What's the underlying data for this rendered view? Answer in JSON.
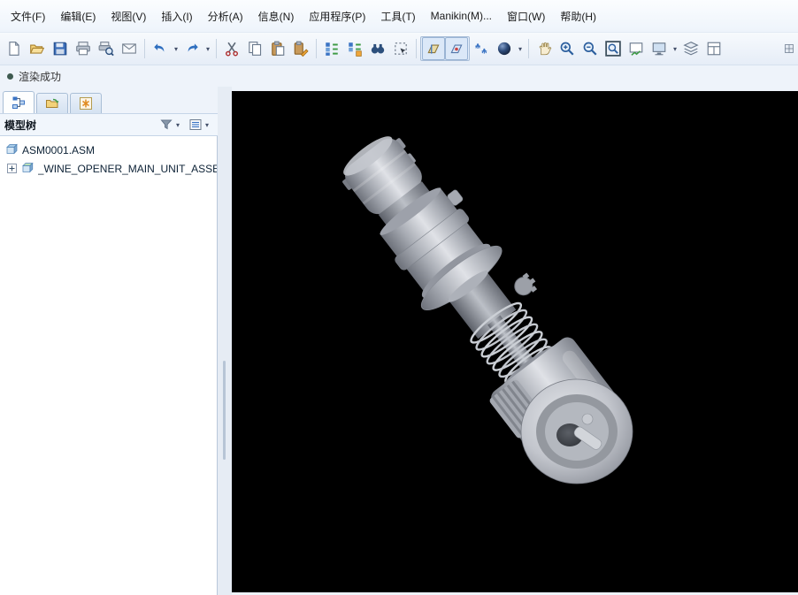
{
  "menubar": {
    "items": [
      {
        "label": "文件(F)"
      },
      {
        "label": "编辑(E)"
      },
      {
        "label": "视图(V)"
      },
      {
        "label": "插入(I)"
      },
      {
        "label": "分析(A)"
      },
      {
        "label": "信息(N)"
      },
      {
        "label": "应用程序(P)"
      },
      {
        "label": "工具(T)"
      },
      {
        "label": "Manikin(M)..."
      },
      {
        "label": "窗口(W)"
      },
      {
        "label": "帮助(H)"
      }
    ]
  },
  "toolbar": {
    "groups": [
      {
        "icons": [
          "new-file-icon",
          "open-file-icon",
          "save-icon",
          "print-icon",
          "print-preview-icon",
          "mail-icon"
        ]
      },
      {
        "icons": [
          "undo-icon",
          "undo-menu-caret",
          "redo-icon",
          "redo-menu-caret"
        ]
      },
      {
        "icons": [
          "cut-icon",
          "copy-icon",
          "paste-icon",
          "paste-special-icon"
        ]
      },
      {
        "icons": [
          "regenerate-icon",
          "regenerate-options-icon",
          "find-icon",
          "selection-filter-icon"
        ]
      },
      {
        "icons": [
          "datum-display-icon",
          "datum-tags-icon",
          "annotation-display-icon",
          "shaded-view-icon",
          "shaded-view-caret"
        ]
      },
      {
        "icons": [
          "spin-icon",
          "zoom-in-icon",
          "zoom-out-icon",
          "refit-icon",
          "repaint-icon",
          "saved-views-icon",
          "layers-icon",
          "view-manager-icon",
          "clipped-toolbar-icon"
        ]
      }
    ]
  },
  "statusbar": {
    "message": "渲染成功"
  },
  "model_tree": {
    "title": "模型树",
    "tabs": [
      "model-tree-tab",
      "folder-browser-tab",
      "favorites-tab"
    ],
    "nodes": [
      {
        "label": "ASM0001.ASM",
        "expandable": false
      },
      {
        "label": "_WINE_OPENER_MAIN_UNIT_ASSE",
        "expandable": true
      }
    ]
  },
  "viewport": {
    "background": "#000000",
    "model": "Wine opener main unit assembly — shaded 3D view"
  },
  "colors": {
    "accent_blue": "#2f6fbf",
    "panel_bg": "#eef3fa",
    "viewport_bg": "#000000",
    "model_gray": "#b9bdc4"
  }
}
